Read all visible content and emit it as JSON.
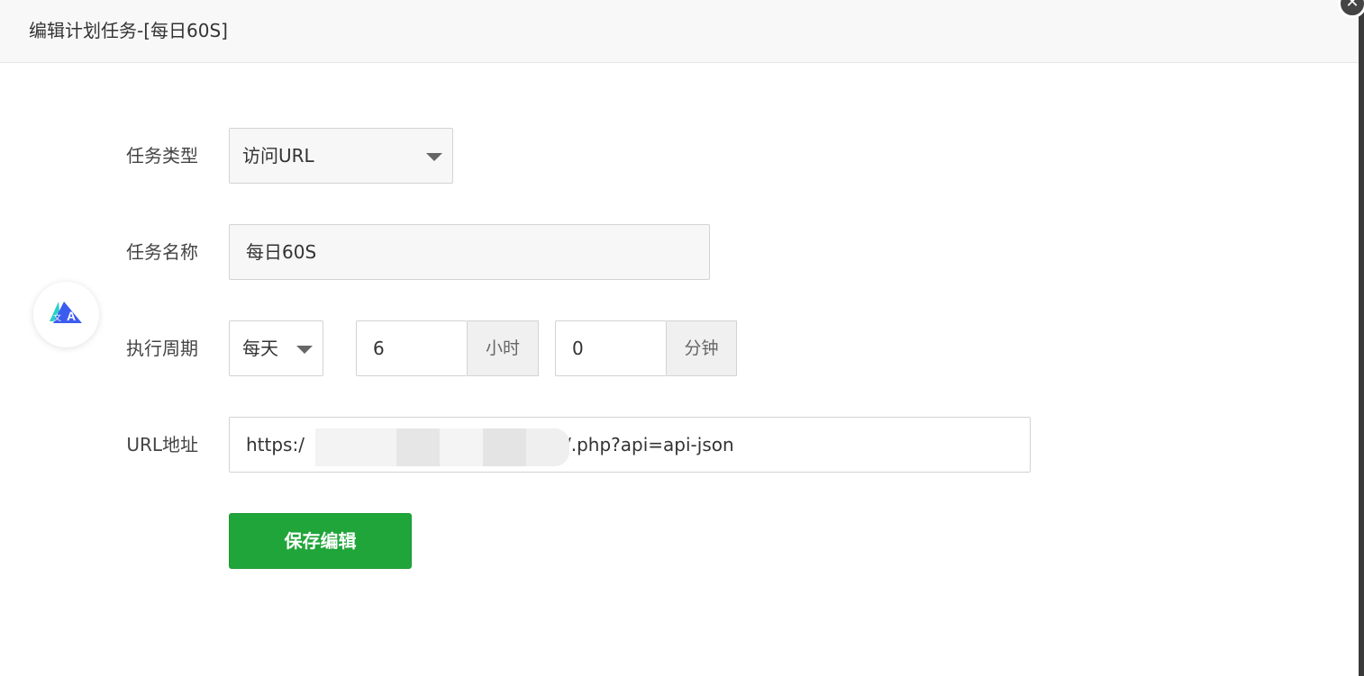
{
  "dialog": {
    "title": "编辑计划任务-[每日60S]",
    "close_glyph": "✕"
  },
  "form": {
    "task_type": {
      "label": "任务类型",
      "value": "访问URL"
    },
    "task_name": {
      "label": "任务名称",
      "value": "每日60S"
    },
    "schedule": {
      "label": "执行周期",
      "period_value": "每天",
      "hour_value": "6",
      "hour_unit": "小时",
      "minute_value": "0",
      "minute_unit": "分钟"
    },
    "url": {
      "label": "URL地址",
      "value_prefix": "https:/",
      "value_suffix": "/.php?api=api-json"
    }
  },
  "actions": {
    "save_label": "保存编辑"
  },
  "icons": {
    "close": "close-icon",
    "caret": "caret-down-icon",
    "floating_logo": "translate-assistant-icon"
  },
  "colors": {
    "accent_green": "#20a53a",
    "logo_cyan": "#2ad0c8",
    "logo_blue": "#3c5cf0"
  }
}
